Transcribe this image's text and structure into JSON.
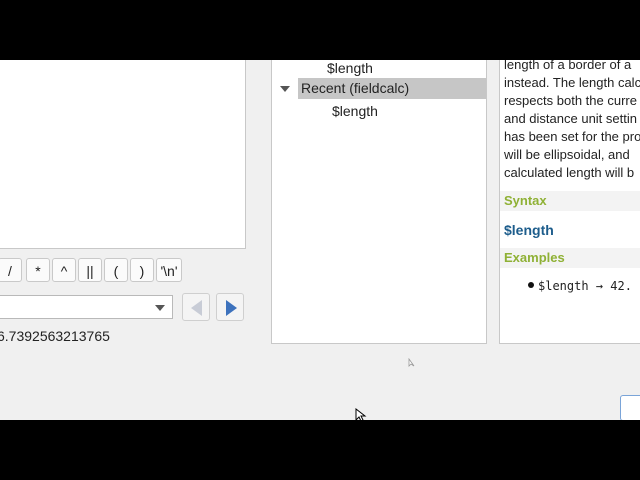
{
  "operators": [
    "/",
    "*",
    "^",
    "||",
    "(",
    ")",
    "'\\n'"
  ],
  "preview": {
    "text": "6.7392563213765"
  },
  "tree": {
    "items": [
      {
        "label": "$length"
      },
      {
        "label": "Recent (fieldcalc)"
      },
      {
        "label": "$length"
      }
    ]
  },
  "help": {
    "description_lines": [
      "length of a border of a",
      "instead. The length calc",
      "respects both the curre",
      "and distance unit settin",
      "has been set for the pro",
      "will be ellipsoidal, and",
      "calculated length will b"
    ],
    "syntax_heading": "Syntax",
    "syntax": "$length",
    "examples_heading": "Examples",
    "example": "$length → 42."
  },
  "colors": {
    "heading": "#8fb135",
    "syntax": "#1d5d8c",
    "nav_active": "#3d72bd"
  }
}
